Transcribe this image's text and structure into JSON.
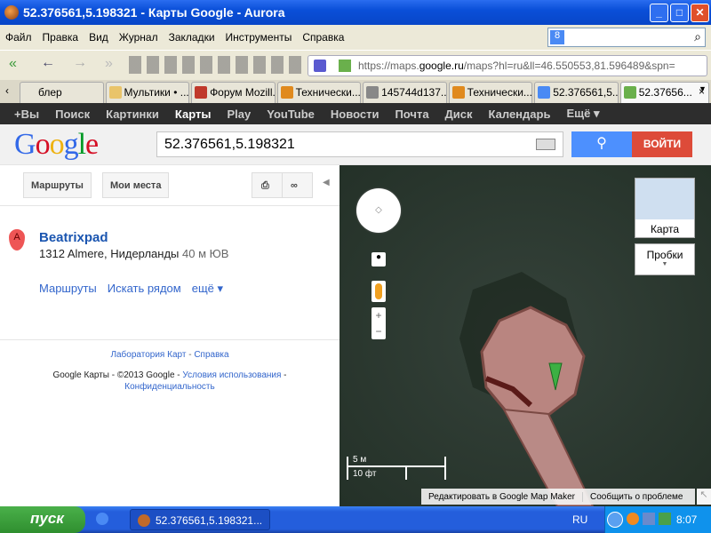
{
  "window": {
    "title": "52.376561,5.198321 - Карты Google - Aurora",
    "min": "_",
    "max": "□",
    "close": "✕"
  },
  "menu": [
    "Файл",
    "Правка",
    "Вид",
    "Журнал",
    "Закладки",
    "Инструменты",
    "Справка"
  ],
  "url": {
    "prefix": "https://maps.",
    "domain": "google.ru",
    "rest": "/maps?hl=ru&ll=46.550553,81.596489&spn="
  },
  "tabs": [
    {
      "label": "блер",
      "color": "#ddd"
    },
    {
      "label": "Мультики • ...",
      "color": "#e9c46a"
    },
    {
      "label": "Форум Mozill...",
      "color": "#c0392b"
    },
    {
      "label": "Технически...",
      "color": "#e08a1e"
    },
    {
      "label": "145744d137...",
      "color": "#888"
    },
    {
      "label": "Технически...",
      "color": "#e08a1e"
    },
    {
      "label": "52.376561,5...",
      "color": "#4a8af4"
    },
    {
      "label": "52.37656...",
      "color": "#6ab04c",
      "close": "×"
    }
  ],
  "gbar": [
    "+Вы",
    "Поиск",
    "Картинки",
    "Карты",
    "Play",
    "YouTube",
    "Новости",
    "Почта",
    "Диск",
    "Календарь",
    "Ещё ▾"
  ],
  "search": {
    "value": "52.376561,5.198321",
    "login": "ВОЙТИ"
  },
  "left": {
    "routes_btn": "Маршруты",
    "places_btn": "Мои места",
    "result": {
      "marker": "A",
      "title": "Beatrixpad",
      "address": "1312 Almere, Нидерланды",
      "distance": "40 м ЮВ",
      "actions": [
        "Маршруты",
        "Искать рядом",
        "ещё ▾"
      ]
    },
    "footer": {
      "labs": "Лаборатория Карт",
      "help": "Справка",
      "copyright": "Google Карты - ©2013 Google -",
      "terms": "Условия использования",
      "privacy": "Конфиденциальность"
    }
  },
  "map": {
    "type_label": "Карта",
    "traffic_label": "Пробки",
    "scale_m": "5 м",
    "scale_ft": "10 фт",
    "edit_link": "Редактировать в Google Map Maker",
    "report_link": "Сообщить о проблеме"
  },
  "taskbar": {
    "start": "пуск",
    "window": "52.376561,5.198321...",
    "lang": "RU",
    "time": "8:07"
  }
}
